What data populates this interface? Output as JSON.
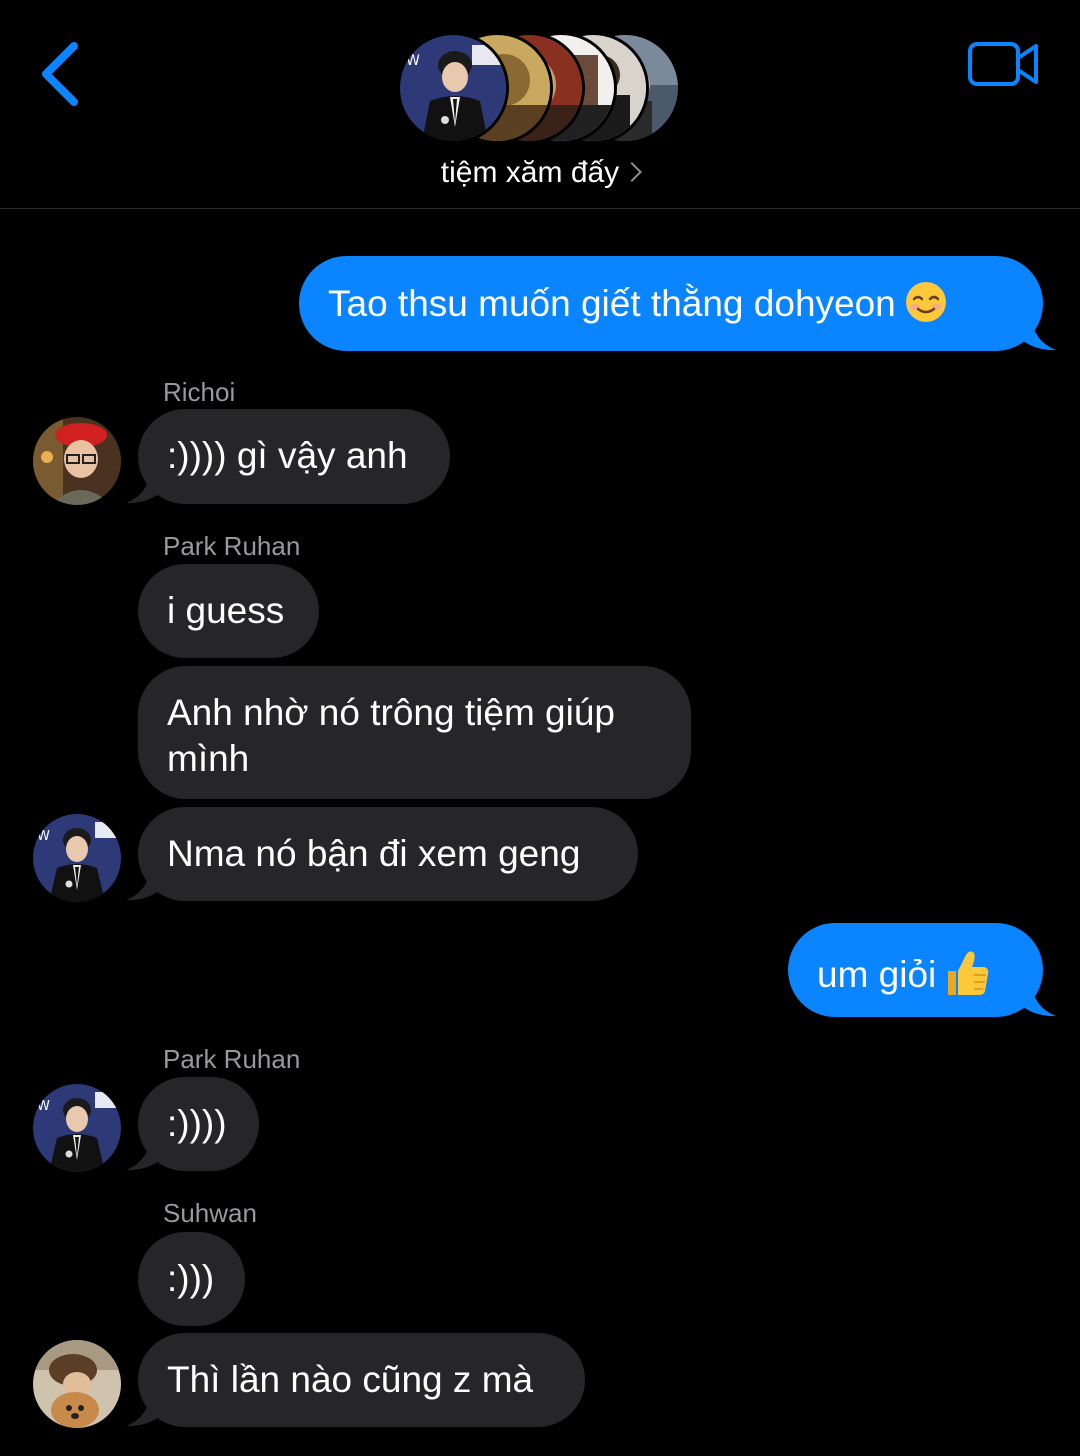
{
  "header": {
    "group_name": "tiệm xăm đấy",
    "accent_color": "#0a84ff",
    "back_icon": "chevron-left-icon",
    "video_icon": "video-camera-icon"
  },
  "messages": [
    {
      "direction": "out",
      "text": "Tao thsu muốn giết thằng dohyeon",
      "emoji": "smiling-face-emoji"
    },
    {
      "direction": "in",
      "sender": "Richoi",
      "text": ":)))) gì vậy anh"
    },
    {
      "direction": "in",
      "sender": "Park Ruhan",
      "text": "i guess"
    },
    {
      "direction": "in",
      "text_line1": "Anh nhờ nó trông tiệm giúp",
      "text_line2": "mình"
    },
    {
      "direction": "in",
      "text": "Nma nó bận đi xem geng"
    },
    {
      "direction": "out",
      "text": "um giỏi",
      "emoji": "thumbs-up-emoji"
    },
    {
      "direction": "in",
      "sender": "Park Ruhan",
      "text": ":))))"
    },
    {
      "direction": "in",
      "sender": "Suhwan",
      "text": ":)))"
    },
    {
      "direction": "in",
      "text": "Thì lần nào cũng z mà"
    }
  ]
}
